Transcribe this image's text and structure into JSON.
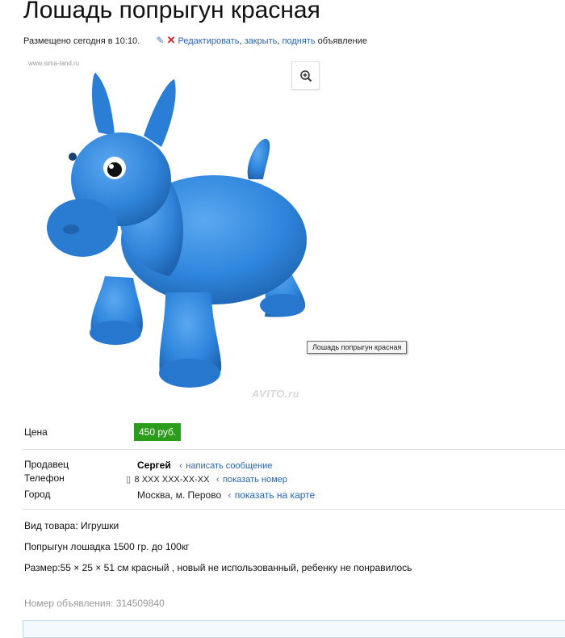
{
  "ad": {
    "title": "Лошадь попрыгун красная",
    "posted": "Размещено сегодня в 10:10.",
    "actions": {
      "edit": "Редактировать",
      "comma1": ",",
      "close": "закрыть",
      "comma2": ",",
      "raise": "поднять",
      "suffix": "объявление"
    }
  },
  "image": {
    "watermark_site": "www.sima-land.ru",
    "tooltip": "Лошадь попрыгун красная",
    "watermark_avito": "AVITO.ru",
    "toy_color": "#2f86dd"
  },
  "price": {
    "label": "Цена",
    "value": "450 руб.",
    "badge_color": "#2a9d1a"
  },
  "seller": {
    "seller_label": "Продавец",
    "seller_name": "Сергей",
    "message_link": "написать сообщение",
    "phone_label": "Телефон",
    "phone_value": "8 XXX XXX-XX-XX",
    "phone_link": "показать номер",
    "city_label": "Город",
    "city_value": "Москва, м. Перово",
    "map_link": "показать на карте"
  },
  "details": {
    "type_label": "Вид товара:",
    "type_value": "Игрушки",
    "line1": "Попрыгун лошадка 1500 гр. до 100кг",
    "line2": "Размер:55 × 25 × 51 см красный , новый не использованный, ребенку не понравилось",
    "ad_number": "Номер объявления: 314509840"
  },
  "icons": {
    "edit": "pencil-icon",
    "close": "cross-icon",
    "zoom": "zoom-in-icon",
    "phone": "phone-icon",
    "link_arrow": "small-arrow-icon"
  }
}
